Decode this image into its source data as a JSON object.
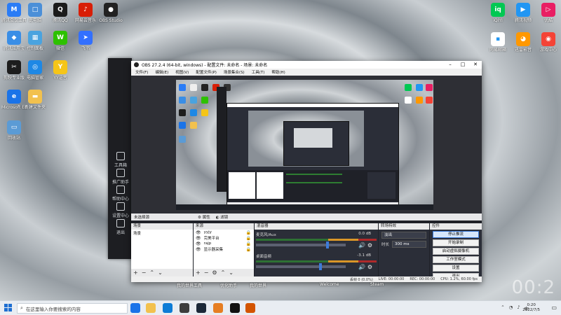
{
  "desktop_left": [
    {
      "label": "腾讯会议工具",
      "color": "#2a7cf6",
      "glyph": "M"
    },
    {
      "label": "此电脑",
      "color": "#4b8fd8",
      "glyph": "□"
    },
    {
      "label": "腾讯QQ",
      "color": "#1b1b1b",
      "glyph": "Q"
    },
    {
      "label": "网易云音乐",
      "color": "#d81e06",
      "glyph": "♪"
    },
    {
      "label": "OBS Studio",
      "color": "#222222",
      "glyph": "●"
    },
    {
      "label": "腾讯应用宝",
      "color": "#3a8ee6",
      "glyph": "◆"
    },
    {
      "label": "控制面板",
      "color": "#4aa3df",
      "glyph": "▦"
    },
    {
      "label": "微信",
      "color": "#2dc100",
      "glyph": "W"
    },
    {
      "label": "飞书",
      "color": "#3370ff",
      "glyph": "➤"
    },
    {
      "label": "剪映专业版",
      "color": "#1d1d1d",
      "glyph": "✂"
    },
    {
      "label": "电脑管家",
      "color": "#1e88e5",
      "glyph": "◎"
    },
    {
      "label": "YY语音",
      "color": "#f5c518",
      "glyph": "Y"
    },
    {
      "label": "Microsoft Edge",
      "color": "#1a73e8",
      "glyph": "e"
    },
    {
      "label": "新建文件夹",
      "color": "#f2c14e",
      "glyph": "▬"
    },
    {
      "label": "回收站",
      "color": "#5b9bd5",
      "glyph": "▭"
    }
  ],
  "desktop_right": [
    {
      "label": "iQIYI",
      "color": "#00c853",
      "glyph": "iq"
    },
    {
      "label": "腾讯视频",
      "color": "#2196f3",
      "glyph": "▶"
    },
    {
      "label": "优酷",
      "color": "#e91e63",
      "glyph": "▷"
    },
    {
      "label": "网易邮箱",
      "color": "#ffffff",
      "glyph": "▪"
    },
    {
      "label": "迅雷影音",
      "color": "#ff9800",
      "glyph": "◕"
    },
    {
      "label": "游戏中心",
      "color": "#f44336",
      "glyph": "◉"
    }
  ],
  "bg_app": {
    "items": [
      "工具箱",
      "推广助手",
      "帮助中心",
      "设置中心",
      "退出"
    ]
  },
  "obs": {
    "title": "OBS 27.2.4 (64-bit, windows) - 配置文件: 未命名 - 场景: 未命名",
    "menu": [
      "文件(F)",
      "编辑(E)",
      "视图(V)",
      "配置文件(P)",
      "场景集合(S)",
      "工具(T)",
      "帮助(H)"
    ],
    "source_bar": {
      "no_source": "未选择源",
      "props": "属性",
      "filters": "滤镜"
    },
    "scenes": {
      "header": "场景",
      "items": [
        "场景"
      ]
    },
    "sources": {
      "header": "来源",
      "items": [
        {
          "name": "yyjy"
        },
        {
          "name": "完美平台"
        },
        {
          "name": "rajp"
        },
        {
          "name": "显示器采集"
        }
      ]
    },
    "mixer": {
      "header": "混音器",
      "channels": [
        {
          "name": "麦克风/Aux",
          "db": "0.0 dB",
          "level": 0.78
        },
        {
          "name": "桌面音频",
          "db": "-3.1 dB",
          "level": 0.7
        }
      ]
    },
    "transitions": {
      "header": "转场特效",
      "type": "淡出",
      "duration_label": "时长",
      "duration": "300 ms"
    },
    "controls": {
      "header": "控件",
      "buttons": [
        "停止推流",
        "开始录制",
        "启动虚拟摄像机",
        "工作室模式",
        "设置",
        "退出"
      ]
    },
    "status": {
      "live": "LIVE: 00:00:00",
      "rec": "REC: 00:00:00",
      "cpu": "CPU: 1.2%, 60.00 fps",
      "dropped": "丢帧 0 (0.0%)"
    }
  },
  "under_labels": [
    "我的世界工具",
    "优化助手",
    "我的世界",
    "Welcome",
    "Steam"
  ],
  "taskbar": {
    "search_placeholder": "在这里输入你要搜索的内容",
    "apps": [
      {
        "name": "edge",
        "color": "#1a73e8"
      },
      {
        "name": "explorer",
        "color": "#f2c14e"
      },
      {
        "name": "store",
        "color": "#0d7cd6"
      },
      {
        "name": "game",
        "color": "#3d3d3d"
      },
      {
        "name": "steam",
        "color": "#1b2838"
      },
      {
        "name": "app-orange",
        "color": "#e67e22"
      },
      {
        "name": "obs",
        "color": "#111111"
      },
      {
        "name": "app-orange-2",
        "color": "#d35400"
      }
    ],
    "tray_text": "中",
    "time": "0:20",
    "date": "2022/7/5"
  },
  "big_clock": "00:2"
}
